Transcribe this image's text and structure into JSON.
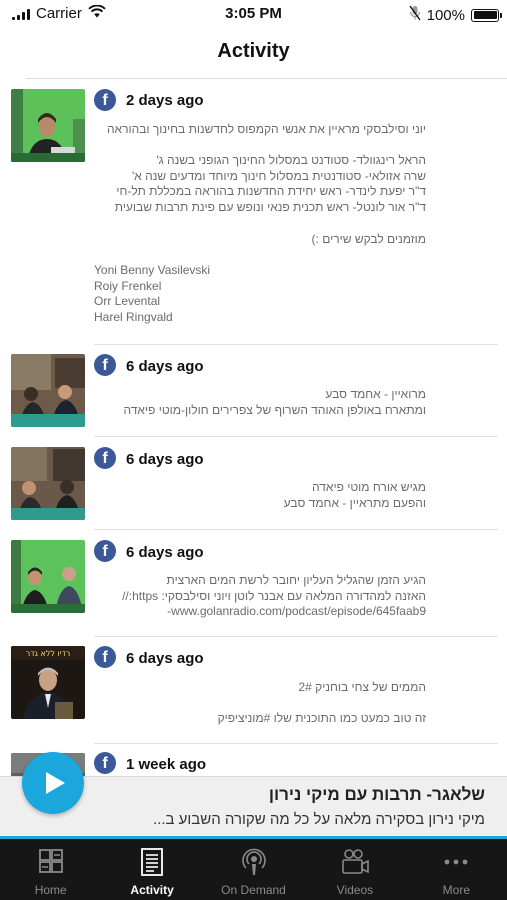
{
  "status_bar": {
    "carrier": "Carrier",
    "time": "3:05 PM",
    "battery": "100%",
    "icons": [
      "signal-bars-icon",
      "wifi-icon",
      "mic-muted-icon",
      "battery-icon"
    ]
  },
  "header": {
    "title": "Activity"
  },
  "feed": {
    "posts": [
      {
        "source_icon": "facebook-icon",
        "source_glyph": "f",
        "time": "2 days ago",
        "paragraphs": [
          "יוני וסילבסקי מראיין את אנשי הקמפוס לחדשנות בחינוך ובהוראה",
          "הראל רינגוולד- סטודנט במסלול החינוך הגופני בשנה ג'\nשרה אזולאי- סטודנטית במסלול חינוך מיוחד ומדעים שנה א'\nד\"ר יפעת לינדר- ראש יחידת החדשנות בהוראה במכללת תל-חי\nד\"ר אור לונטל- ראש תכנית פנאי ונופש עם פינת תרבות שבועית",
          "מוזמנים לבקש שירים :)",
          "Yoni Benny Vasilevski\nRoiy Frenkel\nOrr Levental\nHarel Ringvald"
        ]
      },
      {
        "source_icon": "facebook-icon",
        "source_glyph": "f",
        "time": "6 days ago",
        "paragraphs": [
          "מרואיין - אחמד סבע\nומתארח באולפן האוהד השרוף של צפרירים חולון-מוטי פיאדה"
        ]
      },
      {
        "source_icon": "facebook-icon",
        "source_glyph": "f",
        "time": "6 days ago",
        "paragraphs": [
          "מגיש אורח מוטי פיאדה\nוהפעם מתראיין - אחמד סבע"
        ]
      },
      {
        "source_icon": "facebook-icon",
        "source_glyph": "f",
        "time": "6 days ago",
        "paragraphs": [
          "הגיע הזמן שהגליל העליון יחובר לרשת המים הארצית\nהאזנה למהדורה המלאה עם אבנר לוטן ויוני וסילבסקי: https://\nwww.golanradio.com/podcast/episode/645faab9-"
        ]
      },
      {
        "source_icon": "facebook-icon",
        "source_glyph": "f",
        "time": "6 days ago",
        "thumbnail_caption": "רדיו ללא גדר",
        "paragraphs": [
          "הממים של צחי בוחניק 2#",
          "זה טוב כמעט כמו התוכנית שלו #מוניציפיק"
        ]
      },
      {
        "source_icon": "facebook-icon",
        "source_glyph": "f",
        "time": "1 week ago",
        "paragraphs": []
      }
    ]
  },
  "player": {
    "play_icon": "play-icon",
    "title": "שלאגר- תרבות עם מיקי נירון",
    "subtitle": "מיקי נירון בסקירה מלאה על כל מה שקורה השבוע ב...",
    "progress": 1.0
  },
  "tabs": [
    {
      "label": "Home",
      "icon": "home-grid-icon",
      "active": false
    },
    {
      "label": "Activity",
      "icon": "activity-document-icon",
      "active": true
    },
    {
      "label": "On Demand",
      "icon": "on-demand-podcast-icon",
      "active": false
    },
    {
      "label": "Videos",
      "icon": "videos-camera-icon",
      "active": false
    },
    {
      "label": "More",
      "icon": "more-dots-icon",
      "active": false
    }
  ],
  "colors": {
    "facebook": "#3b5998",
    "accent": "#1ba6dc",
    "tab_bar": "#161616",
    "tab_active": "#ffffff",
    "tab_inactive": "#8a8a8a"
  }
}
